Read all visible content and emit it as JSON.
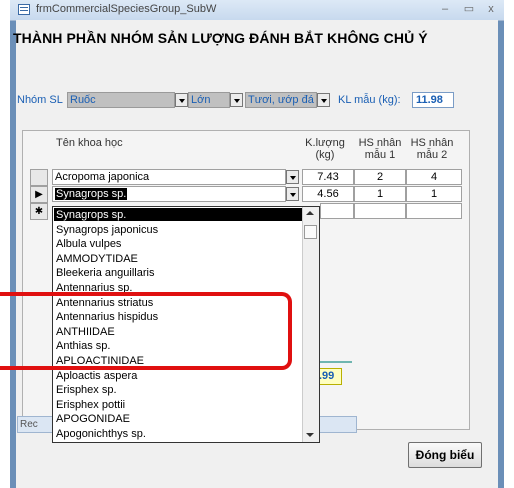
{
  "window": {
    "title": "frmCommercialSpeciesGroup_SubW",
    "minimize": "–",
    "restore": "▭",
    "close": "x"
  },
  "heading": "THÀNH PHẦN NHÓM SẢN LƯỢNG ĐÁNH BẮT KHÔNG CHỦ Ý",
  "filters": {
    "group_label": "Nhóm SL",
    "group_value": "Ruốc",
    "size_value": "Lớn",
    "state_value": "Tươi, ướp đá",
    "kl_label": "KL mẫu (kg):",
    "kl_value": "11.98"
  },
  "table": {
    "headers": {
      "name": "Tên khoa học",
      "weight": "K.lượng\n(kg)",
      "hs1": "HS nhân\nmẫu 1",
      "hs2": "HS nhân\nmẫu 2"
    },
    "rows": [
      {
        "name": "Acropoma japonica",
        "weight": "7.43",
        "hs1": "2",
        "hs2": "4"
      },
      {
        "name": "Synagrops sp.",
        "weight": "4.56",
        "hs1": "1",
        "hs2": "1"
      }
    ],
    "current_marker": "▶",
    "new_marker": "✱"
  },
  "dropdown": {
    "items": [
      "Synagrops sp.",
      "Synagrops japonicus",
      "Albula vulpes",
      "AMMODYTIDAE",
      "Bleekeria anguillaris",
      "Antennarius sp.",
      "Antennarius striatus",
      "Antennarius hispidus",
      "ANTHIIDAE",
      "Anthias sp.",
      "APLOACTINIDAE",
      "Aploactis aspera",
      "Erisphex sp.",
      "Erisphex pottii",
      "APOGONIDAE",
      "Apogonichthys sp."
    ]
  },
  "footer": {
    "partial_value": ".99",
    "record_label": "Rec",
    "close_button": "Đóng biểu"
  },
  "colors": {
    "accent": "#1a5fb4",
    "highlight": "#e01010"
  }
}
